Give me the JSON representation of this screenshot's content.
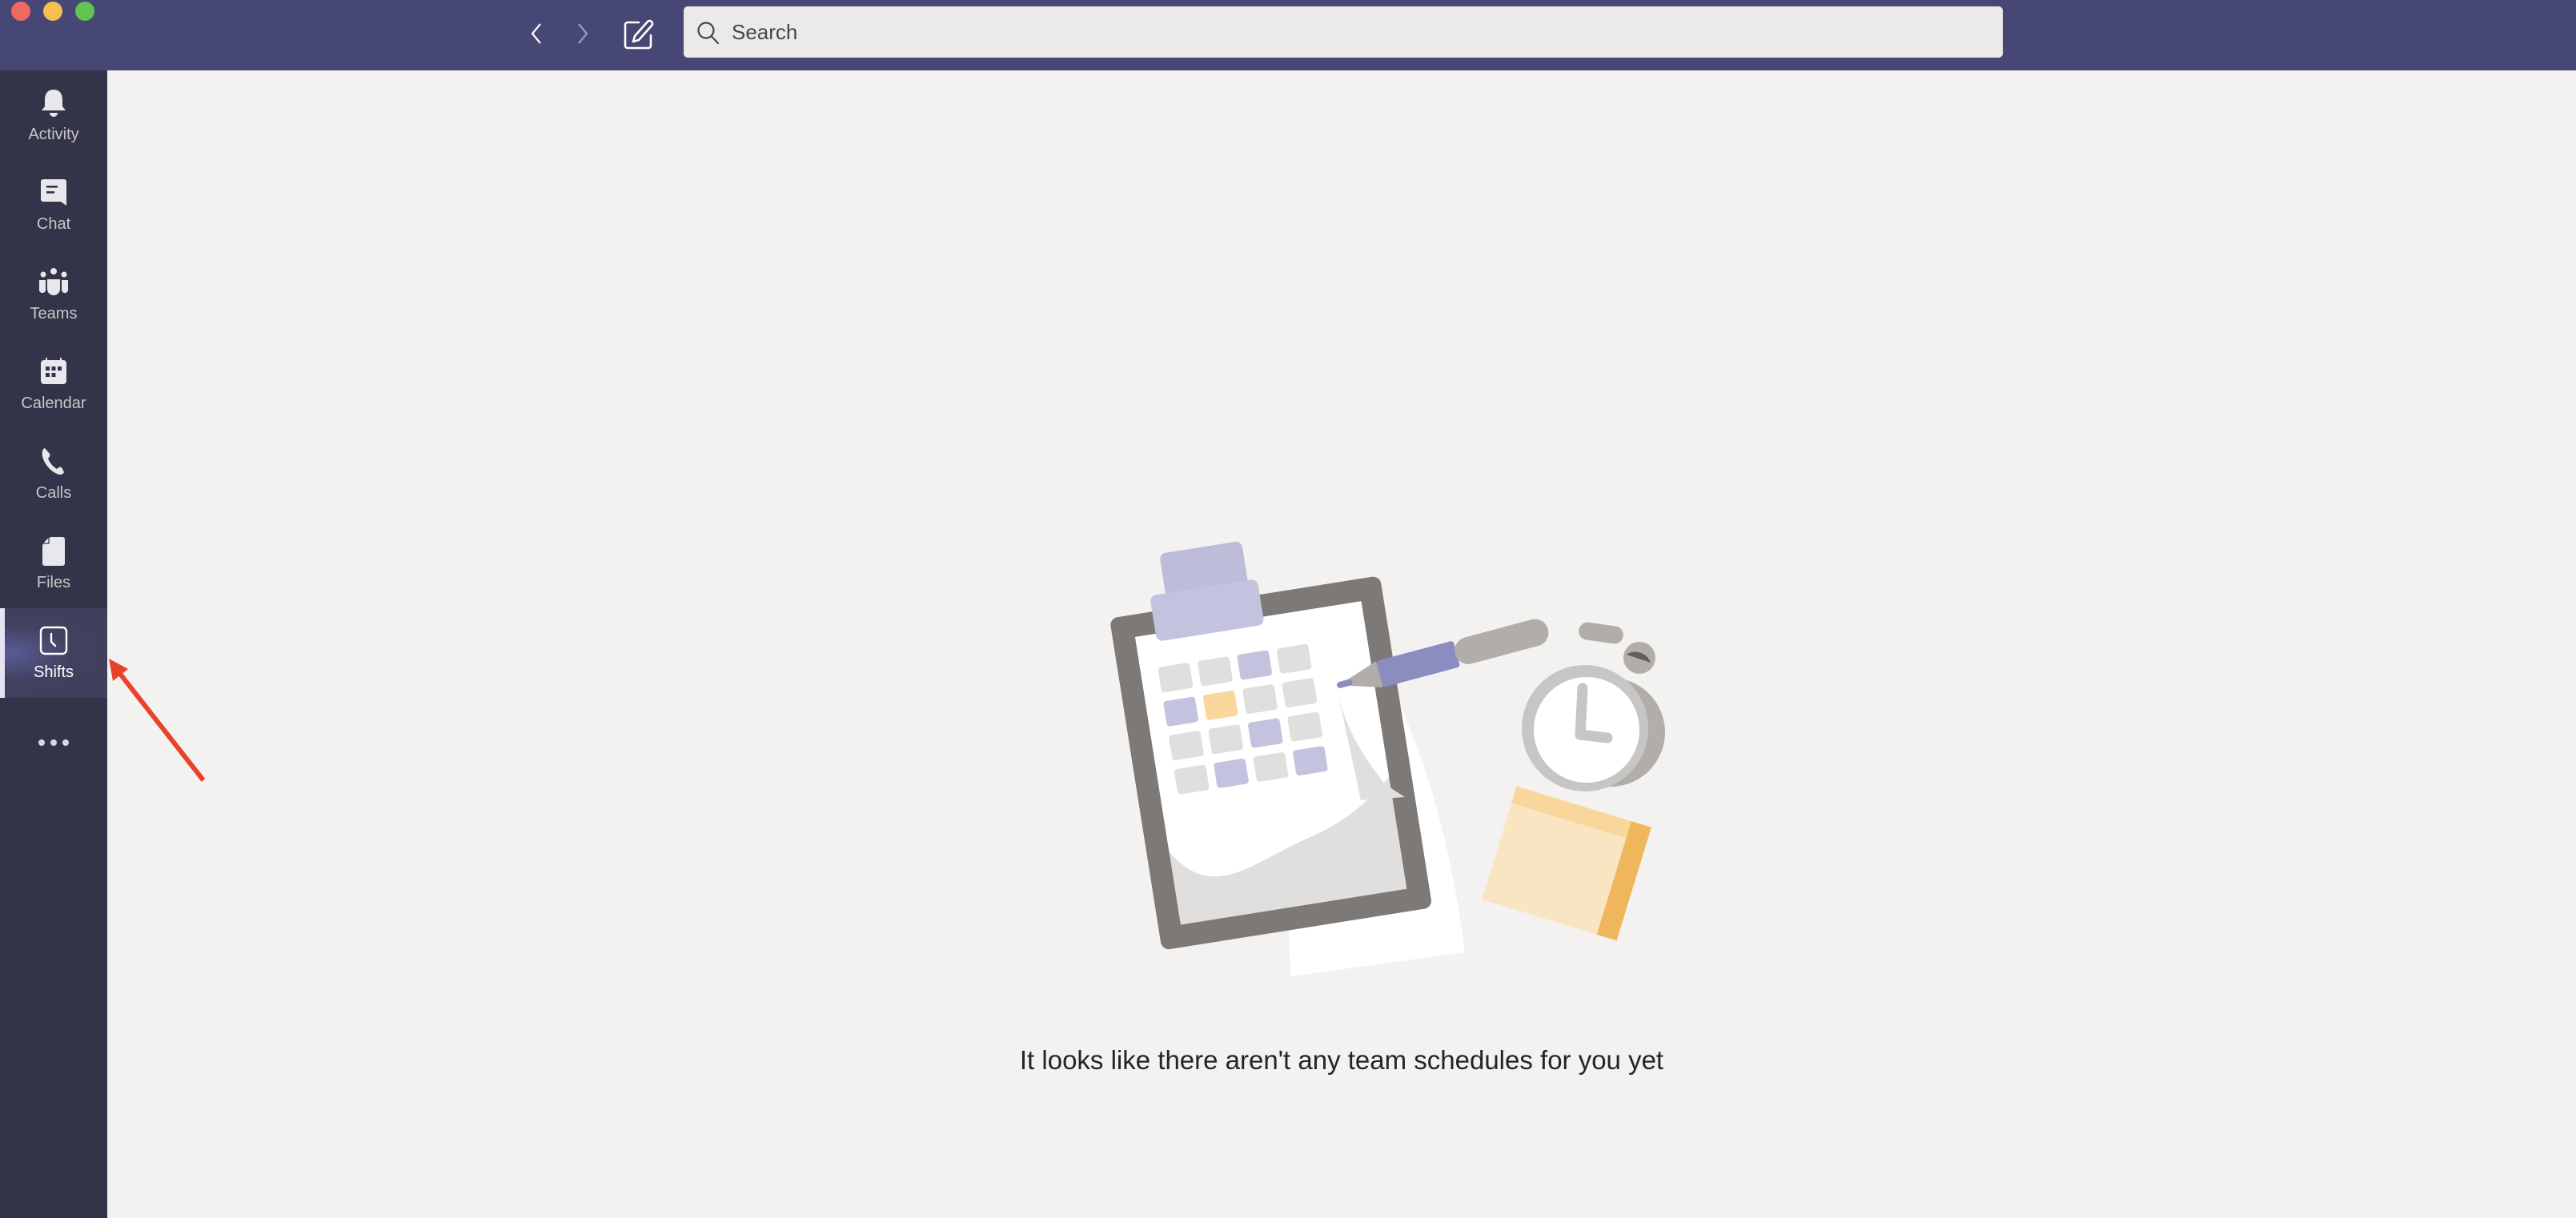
{
  "window": {
    "controls": [
      "close",
      "minimize",
      "maximize"
    ]
  },
  "toolbar": {
    "back_icon": "chevron-left-icon",
    "forward_icon": "chevron-right-icon",
    "compose_icon": "compose-icon",
    "search": {
      "placeholder": "Search",
      "value": "",
      "icon": "search-icon"
    }
  },
  "sidebar": {
    "items": [
      {
        "label": "Activity",
        "icon": "bell-icon",
        "active": false
      },
      {
        "label": "Chat",
        "icon": "chat-icon",
        "active": false
      },
      {
        "label": "Teams",
        "icon": "teams-icon",
        "active": false
      },
      {
        "label": "Calendar",
        "icon": "calendar-icon",
        "active": false
      },
      {
        "label": "Calls",
        "icon": "phone-icon",
        "active": false
      },
      {
        "label": "Files",
        "icon": "file-icon",
        "active": false
      },
      {
        "label": "Shifts",
        "icon": "clock-icon",
        "active": true
      }
    ],
    "more_icon": "more-icon"
  },
  "main": {
    "empty_state": {
      "illustration": "clipboard-schedule-illustration",
      "message": "It looks like there aren't any team schedules for you yet"
    }
  },
  "annotation": {
    "type": "arrow",
    "color": "#e8432a",
    "points_to": "sidebar-item-shifts"
  },
  "colors": {
    "titlebar": "#464775",
    "sidebar": "#33344a",
    "content_bg": "#f3f2f1",
    "accent": "#6264a7"
  }
}
